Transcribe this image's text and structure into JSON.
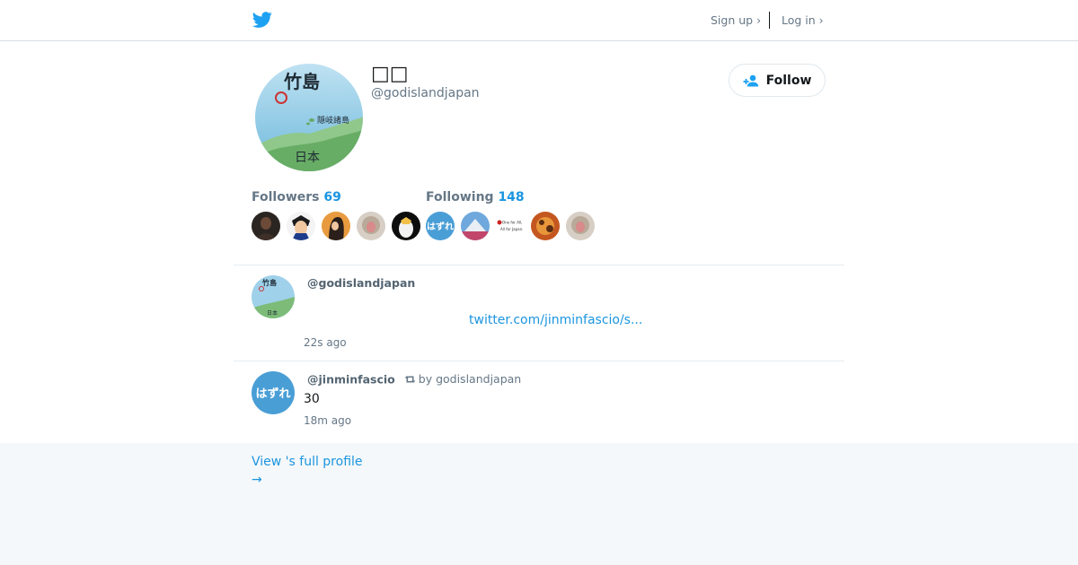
{
  "header": {
    "signup_label": "Sign up ›",
    "login_label": "Log in ›"
  },
  "profile": {
    "display_name": "□□",
    "handle": "@godislandjapan",
    "follow_label": "Follow",
    "avatar_labels": {
      "title": "竹島",
      "islands": "隠岐諸島",
      "country": "日本"
    }
  },
  "stats": {
    "followers_label": "Followers",
    "followers_count": "69",
    "following_label": "Following",
    "following_count": "148"
  },
  "following_badges": {
    "hazure": "はずれ",
    "mini_line1": "One for All,",
    "mini_line2": "All for Japan."
  },
  "tweets": [
    {
      "user": "@godislandjapan",
      "link": "twitter.com/jinminfascio/s...",
      "time": "22s ago"
    },
    {
      "user": "@jinminfascio",
      "retweet_by": "by godislandjapan",
      "text": "30",
      "time": "18m ago",
      "avatar_label": "はずれ"
    }
  ],
  "footer": {
    "full_profile_label": "View 's full profile",
    "arrow": "→"
  },
  "colors": {
    "accent": "#1b95e0",
    "twitter_blue": "#1da1f2"
  },
  "icons": [
    "twitter-bird-icon",
    "add-user-icon",
    "retweet-icon"
  ]
}
